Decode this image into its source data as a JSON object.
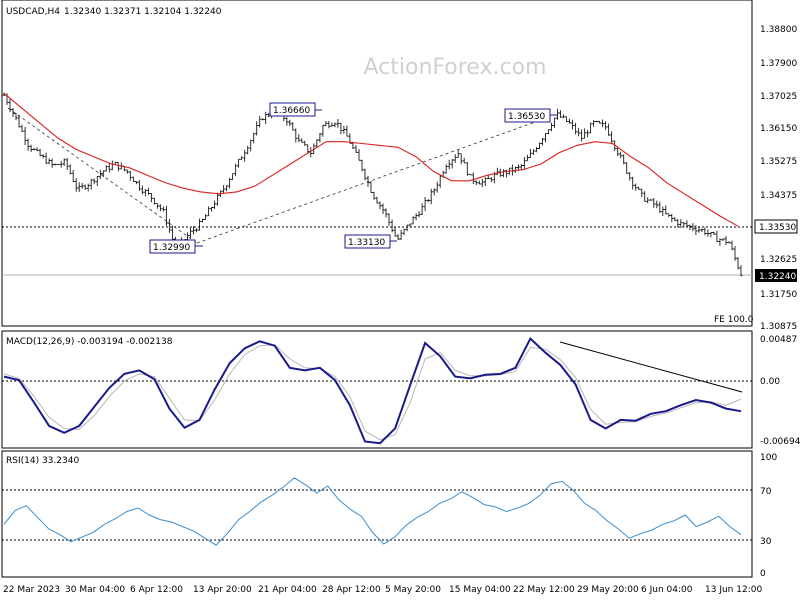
{
  "chart_data": [
    {
      "type": "candlestick",
      "title": "USDCAD,H4",
      "ohlc_header": "1.32340 1.32371 1.32104 1.32240",
      "watermark": "ActionForex.com",
      "yticks": [
        "1.38800",
        "1.37900",
        "1.37025",
        "1.36150",
        "1.35275",
        "1.34375",
        "1.33530",
        "1.32625",
        "1.31750",
        "1.30875"
      ],
      "highlight_levels": [
        {
          "label": "1.33530",
          "value": 1.3353,
          "style": "dotted-line"
        },
        {
          "label": "1.32240",
          "value": 1.3224,
          "style": "solid-line"
        }
      ],
      "swing_labels": [
        "1.36660",
        "1.32990",
        "1.33130",
        "1.36530"
      ],
      "fe_label": "FE 100.0",
      "series": [
        {
          "name": "price",
          "close_path": [
            1.3705,
            1.364,
            1.357,
            1.354,
            1.3515,
            1.3525,
            1.345,
            1.347,
            1.35,
            1.352,
            1.35,
            1.346,
            1.343,
            1.339,
            1.329,
            1.333,
            1.336,
            1.341,
            1.346,
            1.352,
            1.358,
            1.3645,
            1.366,
            1.364,
            1.358,
            1.355,
            1.3625,
            1.3635,
            1.359,
            1.352,
            1.344,
            1.339,
            1.3315,
            1.336,
            1.34,
            1.345,
            1.352,
            1.355,
            1.348,
            1.347,
            1.349,
            1.35,
            1.351,
            1.355,
            1.36,
            1.3653,
            1.363,
            1.359,
            1.363,
            1.362,
            1.355,
            1.348,
            1.343,
            1.341,
            1.338,
            1.336,
            1.335,
            1.334,
            1.332,
            1.331,
            1.3224
          ]
        },
        {
          "name": "moving-average",
          "path": [
            1.371,
            1.367,
            1.363,
            1.359,
            1.356,
            1.354,
            1.352,
            1.351,
            1.349,
            1.347,
            1.3455,
            1.3445,
            1.344,
            1.3445,
            1.346,
            1.349,
            1.352,
            1.355,
            1.358,
            1.358,
            1.3575,
            1.357,
            1.3565,
            1.354,
            1.35,
            1.3475,
            1.3475,
            1.349,
            1.35,
            1.3505,
            1.352,
            1.355,
            1.357,
            1.358,
            1.3575,
            1.354,
            1.351,
            1.347,
            1.344,
            1.341,
            1.338,
            1.3353
          ]
        }
      ]
    },
    {
      "type": "line",
      "title": "MACD(12,26,9) -0.003194 -0.002138",
      "yticks": [
        "0.00487",
        "0.00",
        "-0.006945"
      ],
      "highlight_levels": [
        {
          "label": "0.00",
          "value": 0,
          "style": "dotted-line"
        }
      ],
      "series": [
        {
          "name": "macd",
          "path": [
            0.0005,
            0.0001,
            -0.0025,
            -0.0052,
            -0.006,
            -0.0052,
            -0.003,
            -0.0008,
            0.0008,
            0.0012,
            0.0002,
            -0.0032,
            -0.0054,
            -0.0045,
            -0.001,
            0.002,
            0.0037,
            0.0045,
            0.004,
            0.0015,
            0.0012,
            0.0015,
            0.0001,
            -0.0028,
            -0.007,
            -0.0072,
            -0.0055,
            -0.0005,
            0.0043,
            0.0028,
            0.0005,
            0.0003,
            0.0007,
            0.0008,
            0.0015,
            0.0048,
            0.0032,
            0.0018,
            -0.0004,
            -0.0045,
            -0.0055,
            -0.0045,
            -0.0046,
            -0.0038,
            -0.0035,
            -0.0028,
            -0.0022,
            -0.0025,
            -0.0032,
            -0.0035
          ]
        },
        {
          "name": "signal",
          "path": [
            0.0008,
            0.0003,
            -0.0018,
            -0.0042,
            -0.0055,
            -0.0056,
            -0.004,
            -0.0018,
            0.0,
            0.0008,
            0.0005,
            -0.002,
            -0.0045,
            -0.0046,
            -0.0022,
            0.0008,
            0.003,
            0.004,
            0.0041,
            0.0025,
            0.0015,
            0.0014,
            0.0005,
            -0.0018,
            -0.0058,
            -0.0068,
            -0.0062,
            -0.0025,
            0.0025,
            0.0032,
            0.0012,
            0.0006,
            0.0006,
            0.0007,
            0.0011,
            0.0038,
            0.0036,
            0.0024,
            0.0004,
            -0.0033,
            -0.005,
            -0.0048,
            -0.0047,
            -0.0041,
            -0.0037,
            -0.0031,
            -0.0025,
            -0.0024,
            -0.0028,
            -0.0021
          ]
        }
      ]
    },
    {
      "type": "line",
      "title": "RSI(14) 33.2340",
      "yticks": [
        "100",
        "70",
        "30",
        "0"
      ],
      "ylim": [
        0,
        100
      ],
      "highlight_levels": [
        {
          "label": "70",
          "value": 70,
          "style": "dotted-line"
        },
        {
          "label": "30",
          "value": 30,
          "style": "dotted-line"
        }
      ],
      "series": [
        {
          "name": "rsi",
          "path": [
            42,
            54,
            58,
            48,
            38,
            33,
            27,
            31,
            35,
            42,
            47,
            53,
            56,
            50,
            46,
            44,
            40,
            36,
            30,
            24,
            34,
            46,
            53,
            61,
            67,
            74,
            82,
            76,
            69,
            75,
            63,
            55,
            49,
            35,
            25,
            31,
            41,
            48,
            53,
            60,
            64,
            70,
            65,
            59,
            57,
            53,
            56,
            60,
            67,
            77,
            79,
            71,
            60,
            54,
            45,
            38,
            30,
            34,
            37,
            42,
            45,
            50,
            40,
            44,
            49,
            40,
            33
          ]
        }
      ]
    }
  ],
  "x_axis": {
    "ticks": [
      "22 Mar 2023",
      "30 Mar 04:00",
      "6 Apr 12:00",
      "13 Apr 20:00",
      "21 Apr 04:00",
      "28 Apr 12:00",
      "5 May 20:00",
      "15 May 04:00",
      "22 May 12:00",
      "29 May 20:00",
      "6 Jun 04:00",
      "13 Jun 12:00"
    ]
  },
  "colors": {
    "price": "#1a1a1a",
    "moving_average": "#dd2020",
    "macd": "#1a1a8c",
    "signal": "#b8b8b8",
    "rsi": "#3a8fd0",
    "grid": "#000000",
    "watermark": "#d0d0d0"
  }
}
